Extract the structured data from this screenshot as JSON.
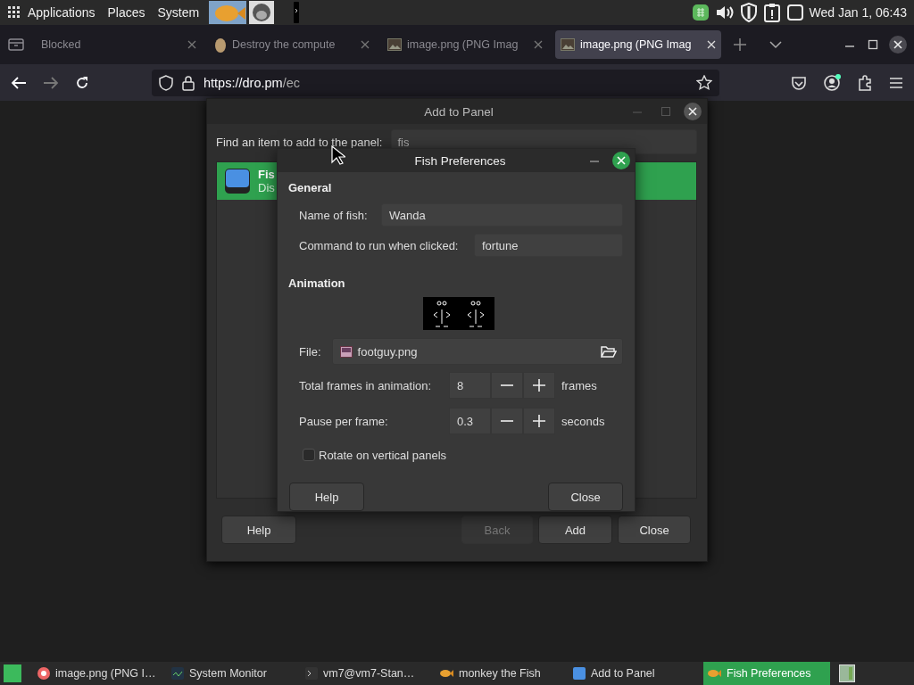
{
  "top_panel": {
    "menus": [
      "Applications",
      "Places",
      "System"
    ],
    "clock": "Wed Jan 1, 06:43"
  },
  "browser": {
    "tabs": [
      {
        "title": "Blocked",
        "selected": false
      },
      {
        "title": "Destroy the compute",
        "selected": false
      },
      {
        "title": "image.png (PNG Imag",
        "selected": false
      },
      {
        "title": "image.png (PNG Imag",
        "selected": true
      }
    ],
    "url": {
      "host": "https://dro.pm",
      "path": "/ec"
    }
  },
  "add_to_panel": {
    "title": "Add to Panel",
    "search_label": "Find an item to add to the panel:",
    "search_value": "fis",
    "items": [
      {
        "name": "Fis",
        "description": "Dis",
        "selected": true
      }
    ],
    "buttons": [
      {
        "label": "Help",
        "disabled": false
      },
      {
        "label": "Back",
        "disabled": true
      },
      {
        "label": "Add",
        "disabled": false
      },
      {
        "label": "Close",
        "disabled": false
      }
    ]
  },
  "fish_preferences": {
    "title": "Fish Preferences",
    "general": {
      "heading": "General",
      "fields": [
        {
          "label": "Name of fish:",
          "value": "Wanda"
        },
        {
          "label": "Command to run when clicked:",
          "value": "fortune"
        }
      ]
    },
    "animation": {
      "heading": "Animation",
      "file_label": "File:",
      "file": "footguy.png",
      "spinners": [
        {
          "label": "Total frames in animation:",
          "value": "8",
          "unit": "frames"
        },
        {
          "label": "Pause per frame:",
          "value": "0.3",
          "unit": "seconds"
        }
      ],
      "rotate": {
        "label": "Rotate on vertical panels",
        "checked": false
      }
    },
    "buttons": [
      "Help",
      "Close"
    ]
  },
  "taskbar": [
    {
      "label": "image.png (PNG I…",
      "selected": false
    },
    {
      "label": "System Monitor",
      "selected": false
    },
    {
      "label": "vm7@vm7-Stan…",
      "selected": false
    },
    {
      "label": "monkey the Fish",
      "selected": false
    },
    {
      "label": "Add to Panel",
      "selected": false
    },
    {
      "label": "Fish Preferences",
      "selected": true
    }
  ]
}
